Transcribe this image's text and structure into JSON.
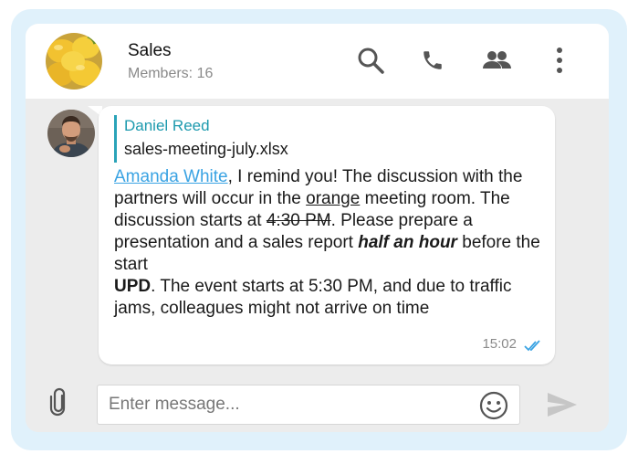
{
  "header": {
    "title": "Sales",
    "members": "Members: 16",
    "icons": [
      "search-icon",
      "phone-icon",
      "members-icon",
      "more-vert-icon"
    ]
  },
  "message": {
    "reply_author": "Daniel Reed",
    "reply_file": "sales-meeting-july.xlsx",
    "mention": "Amanda White",
    "text_1": ",  I remind you! The discussion with the partners will occur in the ",
    "text_orange": "orange",
    "text_2": " meeting room. The discussion starts at ",
    "text_strike": "4:30 PM",
    "text_3": ". Please prepare a presentation and a sales report ",
    "text_emph": "half an hour",
    "text_4": " before the start",
    "upd_label": "UPD",
    "upd_text": ". The event starts at 5:30 PM, and due to traffic jams, colleagues might not arrive on time",
    "time": "15:02",
    "status": "read"
  },
  "composer": {
    "placeholder": "Enter message..."
  },
  "colors": {
    "accent": "#2aa3b8",
    "mention": "#3aa3e3",
    "frame": "#e0f1fb",
    "ticks": "#3aa3e3"
  }
}
